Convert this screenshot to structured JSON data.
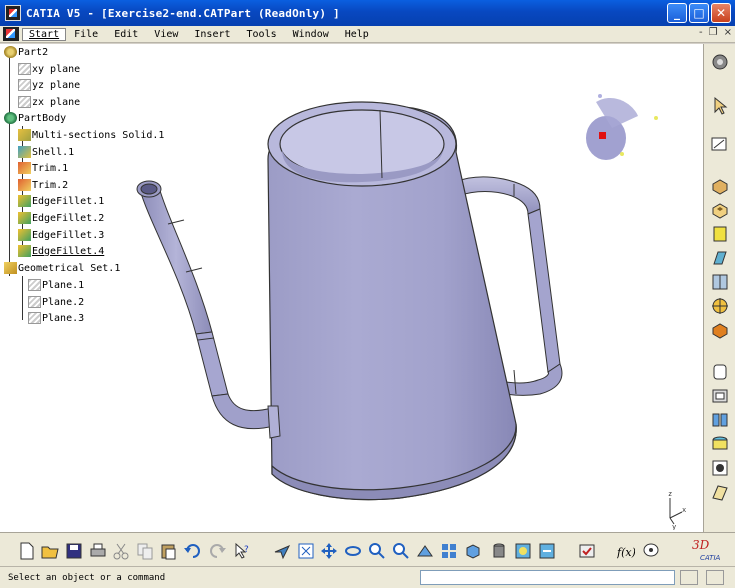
{
  "window": {
    "title": "CATIA V5 - [Exercise2-end.CATPart (ReadOnly) ]",
    "minimize_label": "_",
    "maximize_label": "□",
    "close_label": "✕"
  },
  "menu": {
    "items": [
      "Start",
      "File",
      "Edit",
      "View",
      "Insert",
      "Tools",
      "Window",
      "Help"
    ],
    "doc_minimize": "-",
    "doc_restore": "❐",
    "doc_close": "×"
  },
  "tree": {
    "root": "Part2",
    "planes": [
      "xy plane",
      "yz plane",
      "zx plane"
    ],
    "partbody": "PartBody",
    "features": [
      "Multi-sections Solid.1",
      "Shell.1",
      "Trim.1",
      "Trim.2",
      "EdgeFillet.1",
      "EdgeFillet.2",
      "EdgeFillet.3",
      "EdgeFillet.4"
    ],
    "geo_set": "Geometrical Set.1",
    "geo_planes": [
      "Plane.1",
      "Plane.2",
      "Plane.3"
    ]
  },
  "compass": {
    "x": "x",
    "y": "y",
    "z": "z"
  },
  "status": {
    "message": "Select an object or a command",
    "command_input": ""
  },
  "colors": {
    "titlebar": "#0848c0",
    "model_fill": "#a6a6cc",
    "model_shadow": "#7a7aa4",
    "toolbar_bg": "#ece9d8"
  },
  "icons": {
    "right_toolbar": [
      "sketcher-icon",
      "select-arrow-icon",
      "sketch-icon",
      "pad-icon",
      "pocket-icon",
      "shaft-icon",
      "rib-icon",
      "hole-icon",
      "axis-icon",
      "body-icon",
      "fillet-icon",
      "draft-icon",
      "shell-icon",
      "thickness-icon",
      "measure-icon",
      "sheet-icon"
    ],
    "bottom_toolbar": [
      "new-icon",
      "open-icon",
      "save-icon",
      "print-icon",
      "cut-icon",
      "copy-icon",
      "paste-icon",
      "undo-icon",
      "redo-icon",
      "whats-this-icon",
      "fly-icon",
      "fit-all-icon",
      "pan-icon",
      "rotate-icon",
      "zoom-in-icon",
      "zoom-out-icon",
      "normal-view-icon",
      "multi-view-icon",
      "iso-view-icon",
      "shading-icon",
      "hide-show-icon",
      "swap-visible-icon",
      "update-icon",
      "formula-icon",
      "knowledge-icon",
      "catia-logo"
    ]
  }
}
